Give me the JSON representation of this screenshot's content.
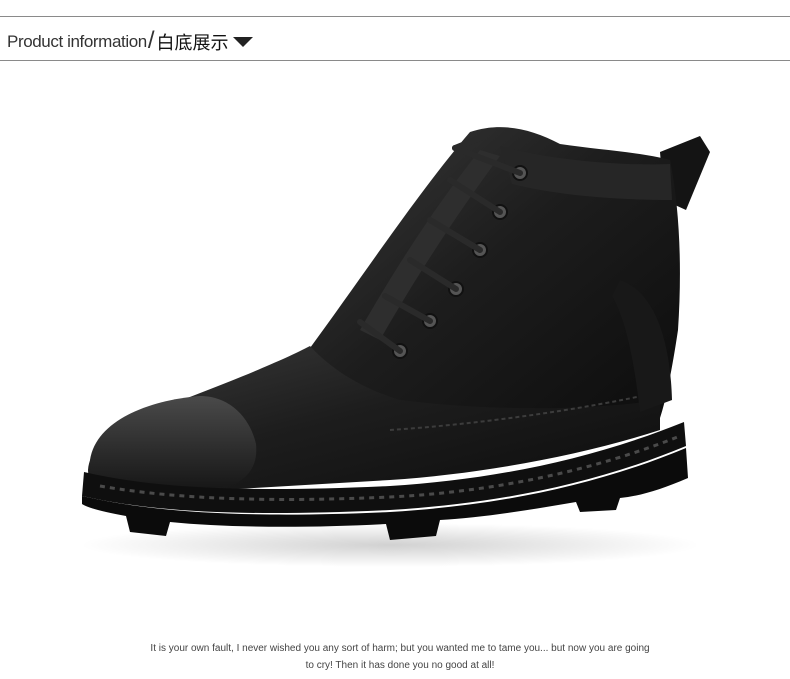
{
  "header": {
    "title_en": "Product information",
    "separator": "/",
    "title_cn": "白底展示",
    "arrow_icon": "triangle-down-icon"
  },
  "product": {
    "description": "Black leather lace-up ankle boot with rubber toe cap and lug sole, shown on white background"
  },
  "caption": {
    "line1": "It is your own fault, I never wished you any sort of harm; but you wanted me to tame you... but now you are going",
    "line2": "to cry! Then it has done you no good at all!"
  },
  "colors": {
    "rule": "#8a8a8a",
    "boot_leather": "#1c1c1c",
    "sole": "#0e0e0e",
    "background": "#ffffff"
  }
}
